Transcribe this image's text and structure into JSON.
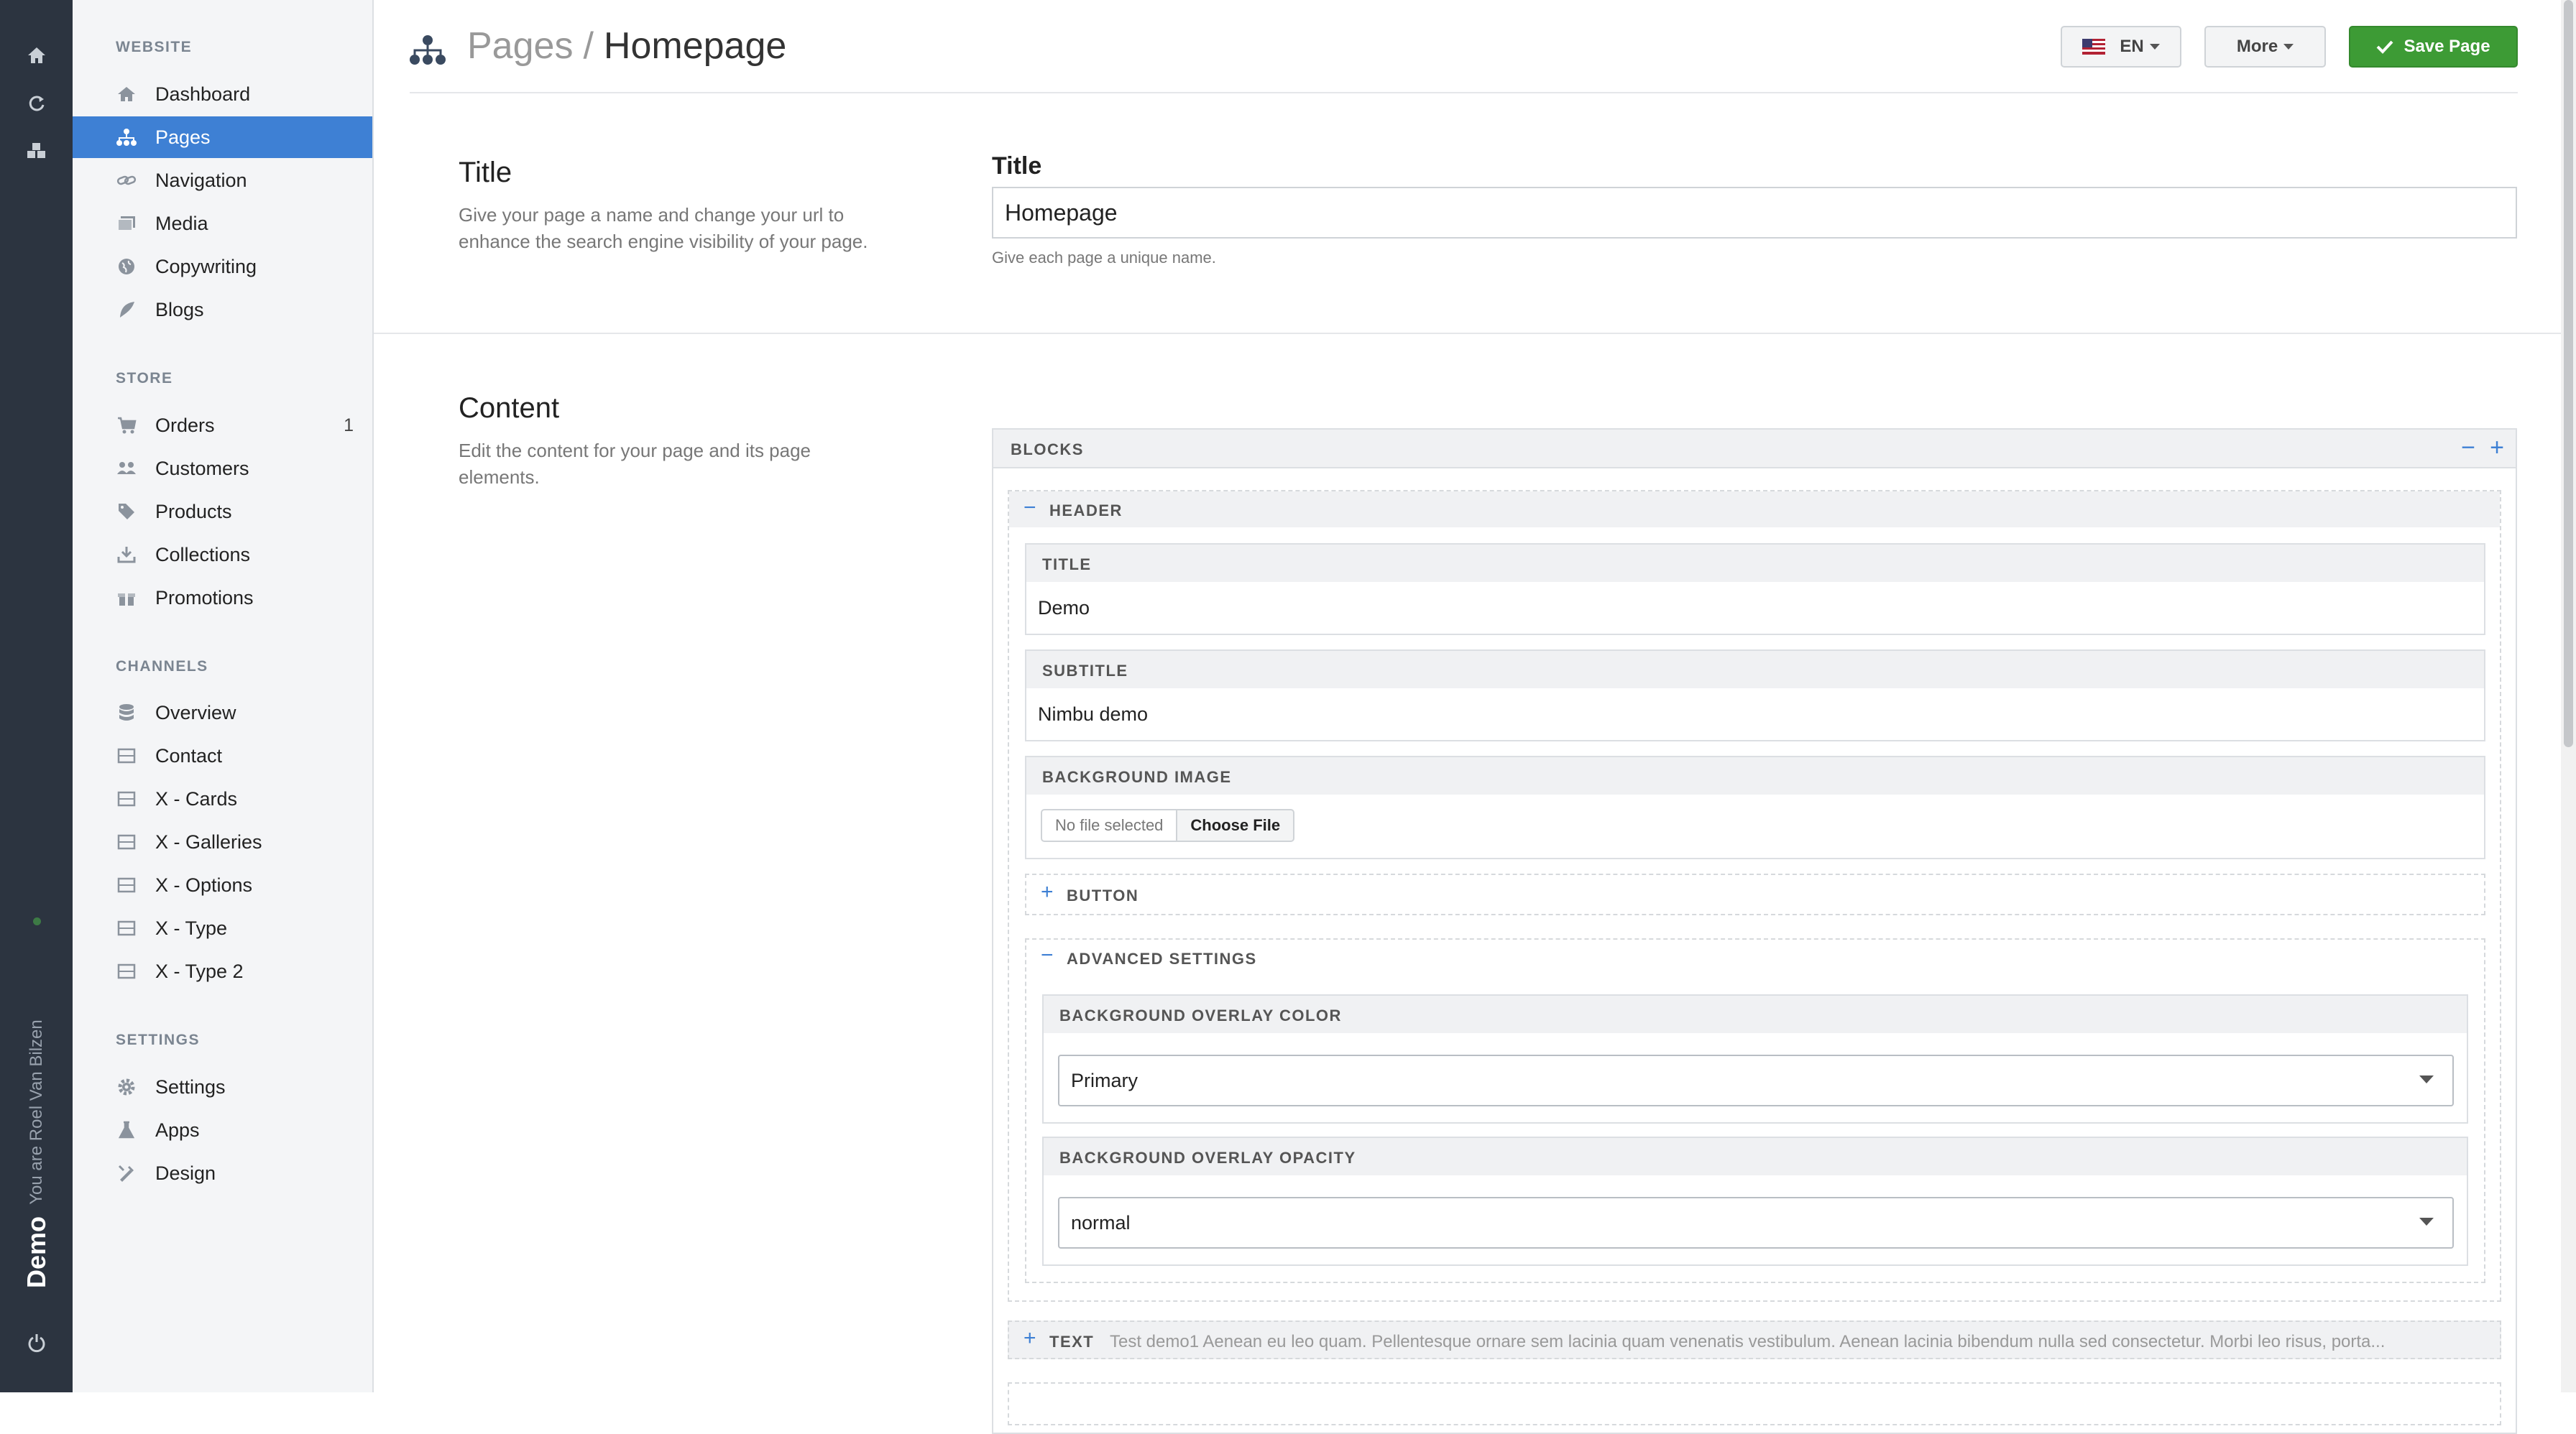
{
  "rail": {
    "user_text": "You are Roel Van Bilzen",
    "brand": "Demo",
    "icons": [
      "home-icon",
      "refresh-icon",
      "cubes-icon",
      "power-icon"
    ]
  },
  "sidebar": {
    "sections": [
      {
        "label": "WEBSITE",
        "items": [
          {
            "label": "Dashboard",
            "icon": "home-icon"
          },
          {
            "label": "Pages",
            "icon": "sitemap-icon",
            "active": true
          },
          {
            "label": "Navigation",
            "icon": "link-icon"
          },
          {
            "label": "Media",
            "icon": "images-icon"
          },
          {
            "label": "Copywriting",
            "icon": "globe-icon"
          },
          {
            "label": "Blogs",
            "icon": "feather-icon"
          }
        ]
      },
      {
        "label": "STORE",
        "items": [
          {
            "label": "Orders",
            "icon": "cart-icon",
            "badge": "1"
          },
          {
            "label": "Customers",
            "icon": "users-icon"
          },
          {
            "label": "Products",
            "icon": "tags-icon"
          },
          {
            "label": "Collections",
            "icon": "download-icon"
          },
          {
            "label": "Promotions",
            "icon": "gift-icon"
          }
        ]
      },
      {
        "label": "CHANNELS",
        "items": [
          {
            "label": "Overview",
            "icon": "database-icon"
          },
          {
            "label": "Contact",
            "icon": "window-icon"
          },
          {
            "label": "X - Cards",
            "icon": "window-icon"
          },
          {
            "label": "X - Galleries",
            "icon": "window-icon"
          },
          {
            "label": "X - Options",
            "icon": "window-icon"
          },
          {
            "label": "X - Type",
            "icon": "window-icon"
          },
          {
            "label": "X - Type 2",
            "icon": "window-icon"
          }
        ]
      },
      {
        "label": "SETTINGS",
        "items": [
          {
            "label": "Settings",
            "icon": "gear-icon"
          },
          {
            "label": "Apps",
            "icon": "flask-icon"
          },
          {
            "label": "Design",
            "icon": "brush-icon"
          }
        ]
      }
    ]
  },
  "header": {
    "breadcrumb_parent": "Pages",
    "separator": "/",
    "breadcrumb_current": "Homepage",
    "language": "EN",
    "more_label": "More",
    "save_label": "Save Page"
  },
  "title_section": {
    "heading": "Title",
    "description": "Give your page a name and change your url to enhance the search engine visibility of your page.",
    "field_label": "Title",
    "field_value": "Homepage",
    "help": "Give each page a unique name."
  },
  "content_section": {
    "heading": "Content",
    "description": "Edit the content for your page and its page elements.",
    "blocks_label": "BLOCKS",
    "header_block": {
      "label": "HEADER",
      "title_label": "TITLE",
      "title_value": "Demo",
      "subtitle_label": "SUBTITLE",
      "subtitle_value": "Nimbu demo",
      "bg_image_label": "BACKGROUND IMAGE",
      "no_file": "No file selected",
      "choose_file": "Choose File",
      "button_label": "BUTTON",
      "advanced_label": "ADVANCED SETTINGS",
      "overlay_color_label": "BACKGROUND OVERLAY COLOR",
      "overlay_color_value": "Primary",
      "overlay_opacity_label": "BACKGROUND OVERLAY OPACITY",
      "overlay_opacity_value": "normal"
    },
    "text_block": {
      "label": "TEXT",
      "preview": "Test demo1 Aenean eu leo quam. Pellentesque ornare sem lacinia quam venenatis vestibulum. Aenean lacinia bibendum nulla sed consectetur. Morbi leo risus, porta..."
    }
  }
}
